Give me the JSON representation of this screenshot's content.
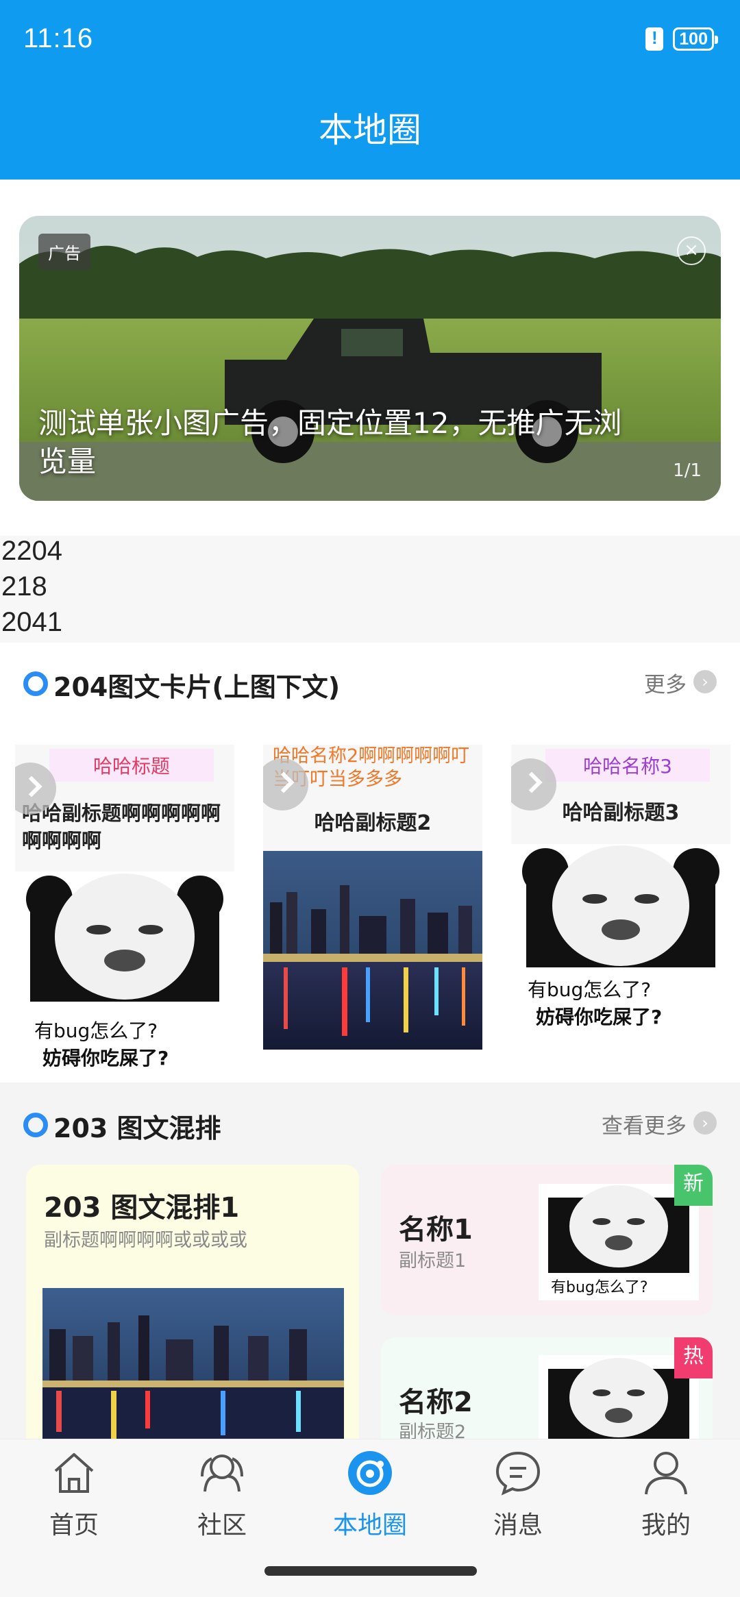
{
  "status_bar": {
    "time": "11:16",
    "battery": "100"
  },
  "header": {
    "title": "本地圈"
  },
  "banner": {
    "ad_label": "广告",
    "close_glyph": "×",
    "title": "测试单张小图广告，固定位置12，无推广无浏览量",
    "counter": "1/1"
  },
  "debug_numbers": [
    "2204",
    "218",
    "2041"
  ],
  "section_204": {
    "title": "204图文卡片(上图下文)",
    "more_label": "更多",
    "cards": [
      {
        "tag": "哈哈标题",
        "subtitle": "哈哈副标题啊啊啊啊啊啊啊啊啊",
        "meme_line1": "有bug怎么了?",
        "meme_line2": "妨碍你吃屎了?"
      },
      {
        "tag": "哈哈名称2啊啊啊啊啊叮当叮叮当多多多",
        "subtitle": "哈哈副标题2"
      },
      {
        "tag": "哈哈名称3",
        "subtitle": "哈哈副标题3",
        "meme_line1": "有bug怎么了?",
        "meme_line2": "妨碍你吃屎了?"
      }
    ]
  },
  "section_203": {
    "title": "203 图文混排",
    "more_label": "查看更多",
    "main": {
      "title": "203 图文混排1",
      "subtitle": "副标题啊啊啊啊或或或或"
    },
    "side": [
      {
        "title": "名称1",
        "subtitle": "副标题1",
        "badge": "新",
        "meme_line": "有bug怎么了?"
      },
      {
        "title": "名称2",
        "subtitle": "副标题2",
        "badge": "热"
      }
    ]
  },
  "nav": {
    "items": [
      {
        "label": "首页"
      },
      {
        "label": "社区"
      },
      {
        "label": "本地圈",
        "active": true
      },
      {
        "label": "消息"
      },
      {
        "label": "我的"
      }
    ]
  },
  "colors": {
    "primary": "#0f9bf0",
    "nav_active": "#1a94ee",
    "new_badge": "#47c46c",
    "hot_badge": "#f03c6e"
  }
}
